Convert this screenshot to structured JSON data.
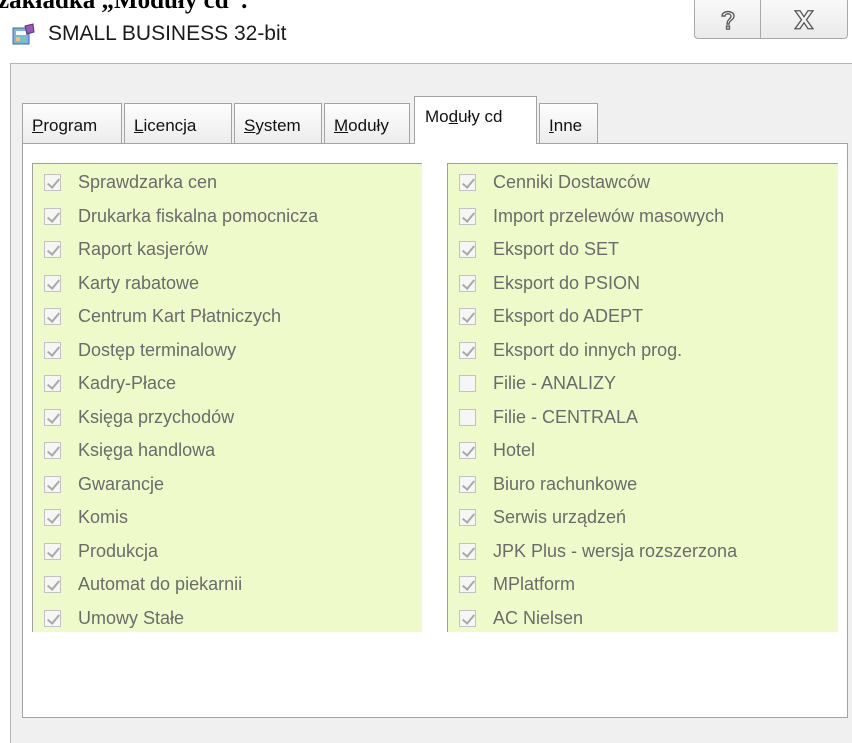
{
  "caption": "zakładka „Moduły cd”.",
  "window": {
    "title": "SMALL BUSINESS 32-bit",
    "app_icon": "app-icon",
    "help_icon": "help-icon",
    "close_icon": "close-icon"
  },
  "tabs": [
    {
      "pre": "",
      "key": "P",
      "post": "rogram",
      "active": false
    },
    {
      "pre": "",
      "key": "L",
      "post": "icencja",
      "active": false
    },
    {
      "pre": "",
      "key": "S",
      "post": "ystem",
      "active": false
    },
    {
      "pre": "",
      "key": "M",
      "post": "oduły",
      "active": false
    },
    {
      "pre": "Mo",
      "key": "d",
      "post": "uły cd",
      "active": true
    },
    {
      "pre": "",
      "key": "I",
      "post": "nne",
      "active": false
    }
  ],
  "modules_left": [
    {
      "label": "Sprawdzarka cen",
      "checked": true
    },
    {
      "label": "Drukarka fiskalna pomocnicza",
      "checked": true
    },
    {
      "label": "Raport kasjerów",
      "checked": true
    },
    {
      "label": "Karty rabatowe",
      "checked": true
    },
    {
      "label": "Centrum Kart Płatniczych",
      "checked": true
    },
    {
      "label": "Dostęp terminalowy",
      "checked": true
    },
    {
      "label": "Kadry-Płace",
      "checked": true
    },
    {
      "label": "Księga przychodów",
      "checked": true
    },
    {
      "label": "Księga handlowa",
      "checked": true
    },
    {
      "label": "Gwarancje",
      "checked": true
    },
    {
      "label": "Komis",
      "checked": true
    },
    {
      "label": "Produkcja",
      "checked": true
    },
    {
      "label": "Automat do piekarnii",
      "checked": true
    },
    {
      "label": "Umowy Stałe",
      "checked": true
    }
  ],
  "modules_right": [
    {
      "label": "Cenniki Dostawców",
      "checked": true
    },
    {
      "label": "Import przelewów masowych",
      "checked": true
    },
    {
      "label": "Eksport do SET",
      "checked": true
    },
    {
      "label": "Eksport do PSION",
      "checked": true
    },
    {
      "label": "Eksport do ADEPT",
      "checked": true
    },
    {
      "label": "Eksport do innych prog.",
      "checked": true
    },
    {
      "label": "Filie - ANALIZY",
      "checked": false
    },
    {
      "label": "Filie - CENTRALA",
      "checked": false
    },
    {
      "label": "Hotel",
      "checked": true
    },
    {
      "label": "Biuro rachunkowe",
      "checked": true
    },
    {
      "label": "Serwis urządzeń",
      "checked": true
    },
    {
      "label": "JPK Plus - wersja rozszerzona",
      "checked": true
    },
    {
      "label": "MPlatform",
      "checked": true
    },
    {
      "label": "AC Nielsen",
      "checked": true
    }
  ],
  "colors": {
    "group_background": "#eefaca",
    "disabled_text": "#6b6b6b"
  }
}
